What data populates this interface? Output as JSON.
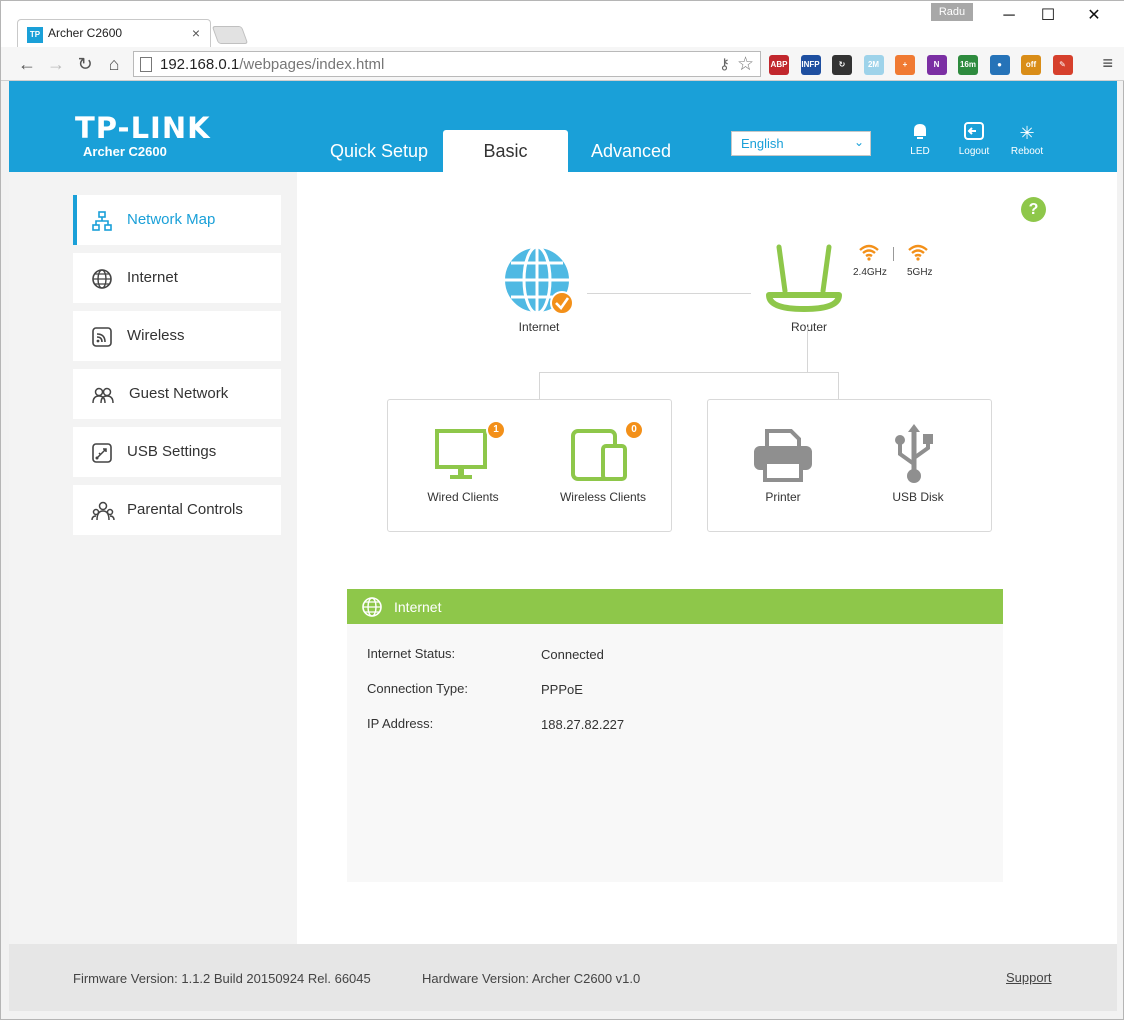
{
  "browser": {
    "tab_title": "Archer C2600",
    "tab_favicon": "TP",
    "tab_close": "×",
    "profile_name": "Radu",
    "url_host": "192.168.0.1",
    "url_path": "/webpages/index.html",
    "extensions": [
      {
        "label": "ABP",
        "color": "#c1272d",
        "icon": "adblock-icon"
      },
      {
        "label": "INFP",
        "color": "#1e4fa0",
        "icon": "infp-icon"
      },
      {
        "label": "↻",
        "color": "#333333",
        "icon": "sync-icon"
      },
      {
        "label": "2M",
        "color": "#9ed3ea",
        "icon": "speed-icon"
      },
      {
        "label": "+",
        "color": "#f07a32",
        "icon": "plus-icon"
      },
      {
        "label": "N",
        "color": "#7b2fa3",
        "icon": "onenote-icon"
      },
      {
        "label": "16m",
        "color": "#2e8b3e",
        "icon": "timer-icon"
      },
      {
        "label": "●",
        "color": "#2673b8",
        "icon": "chart-icon"
      },
      {
        "label": "off",
        "color": "#d98d18",
        "icon": "ghostery-icon"
      },
      {
        "label": "✎",
        "color": "#d6402c",
        "icon": "pen-icon"
      }
    ]
  },
  "header": {
    "logo": "TP-LINK",
    "model": "Archer C2600",
    "tabs": [
      {
        "label": "Quick Setup",
        "active": false
      },
      {
        "label": "Basic",
        "active": true
      },
      {
        "label": "Advanced",
        "active": false
      }
    ],
    "language": "English",
    "buttons": [
      {
        "label": "LED",
        "icon": "bulb-icon"
      },
      {
        "label": "Logout",
        "icon": "logout-icon"
      },
      {
        "label": "Reboot",
        "icon": "reboot-icon"
      }
    ]
  },
  "sidebar": {
    "items": [
      {
        "label": "Network Map",
        "icon": "network-map-icon",
        "active": true
      },
      {
        "label": "Internet",
        "icon": "globe-icon",
        "active": false
      },
      {
        "label": "Wireless",
        "icon": "wireless-icon",
        "active": false
      },
      {
        "label": "Guest Network",
        "icon": "guest-network-icon",
        "active": false
      },
      {
        "label": "USB Settings",
        "icon": "usb-settings-icon",
        "active": false
      },
      {
        "label": "Parental Controls",
        "icon": "parental-controls-icon",
        "active": false
      }
    ]
  },
  "map": {
    "internet_label": "Internet",
    "router_label": "Router",
    "band1": "2.4GHz",
    "band2": "5GHz",
    "wired_label": "Wired Clients",
    "wired_count": "1",
    "wireless_label": "Wireless Clients",
    "wireless_count": "0",
    "printer_label": "Printer",
    "usb_label": "USB Disk",
    "help": "?"
  },
  "internet_panel": {
    "title": "Internet",
    "rows": [
      {
        "label": "Internet Status:",
        "value": "Connected"
      },
      {
        "label": "Connection Type:",
        "value": "PPPoE"
      },
      {
        "label": "IP Address:",
        "value": "188.27.82.227"
      }
    ]
  },
  "footer": {
    "firmware": "Firmware Version: 1.1.2 Build 20150924 Rel. 66045",
    "hardware": "Hardware Version: Archer C2600 v1.0",
    "support": "Support"
  },
  "colors": {
    "brand_blue": "#1aa0d8",
    "accent_green": "#8ec74a",
    "badge_orange": "#f39019"
  }
}
